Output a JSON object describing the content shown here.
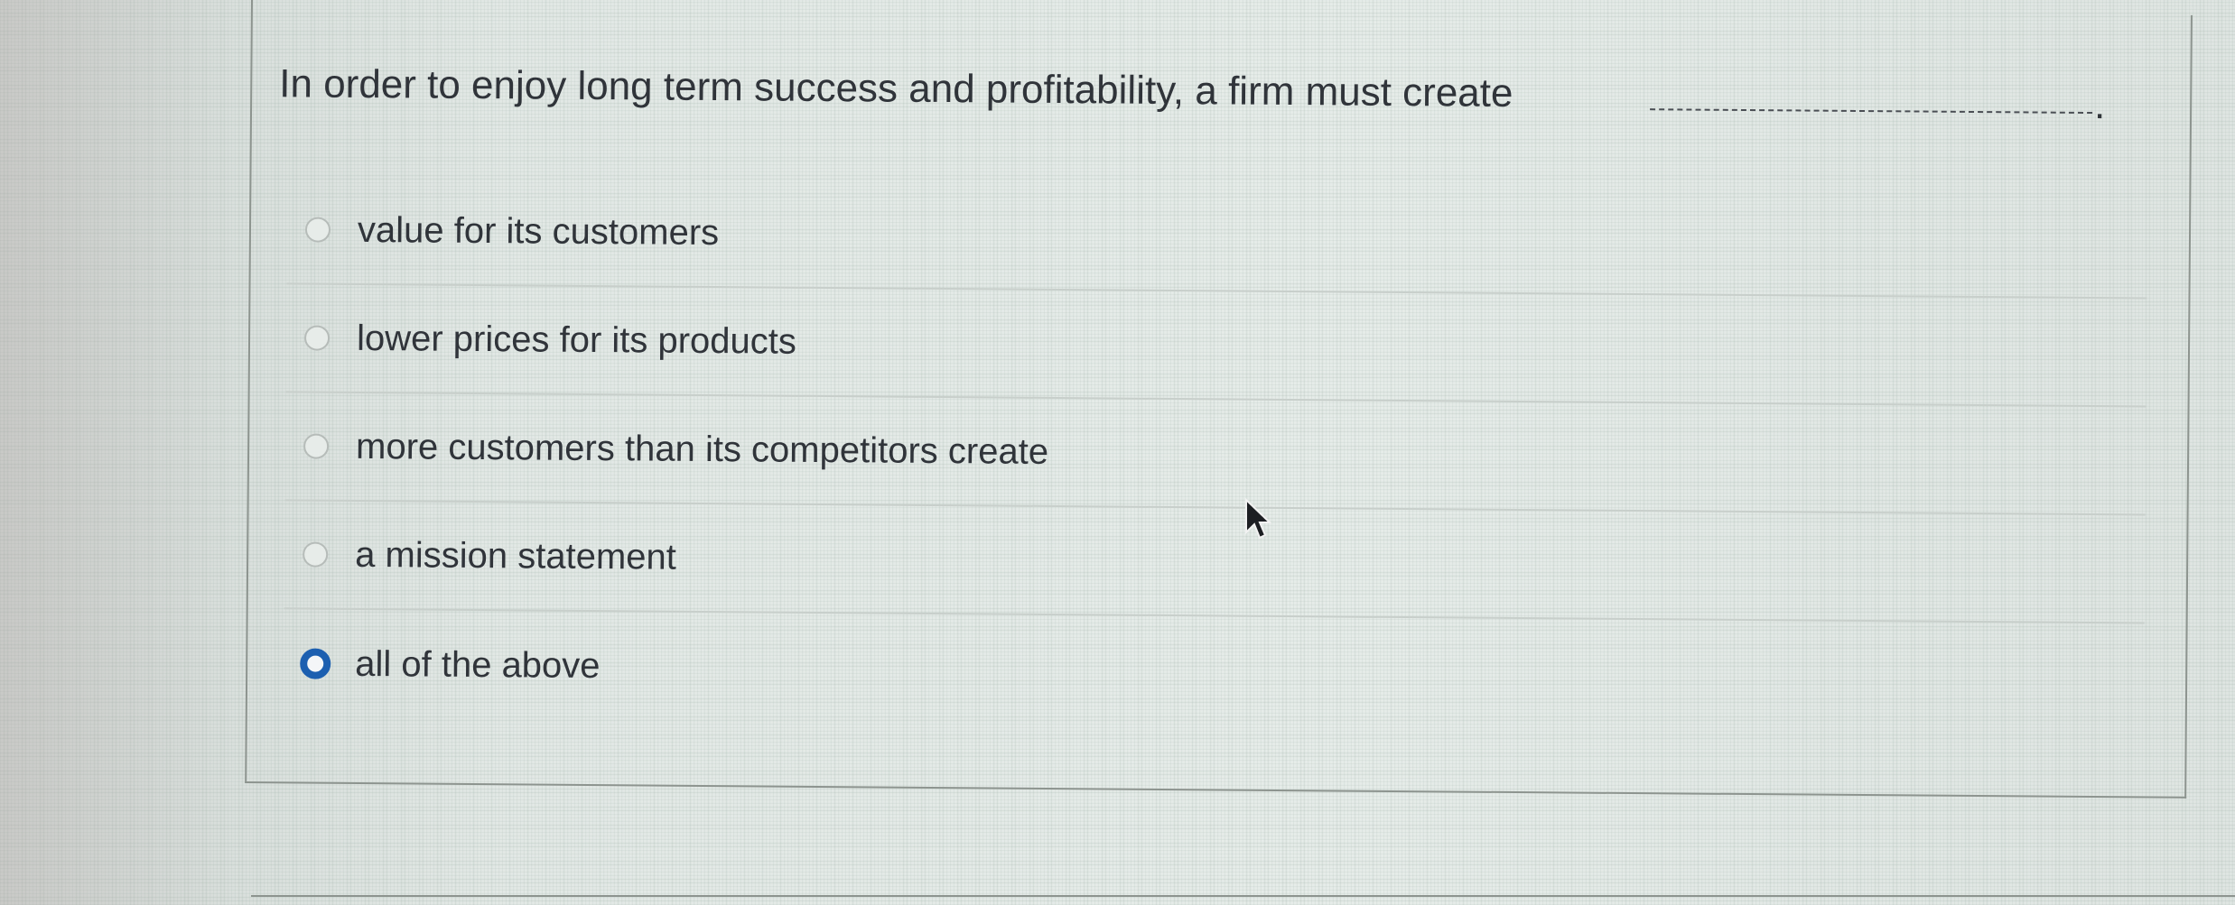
{
  "question": {
    "text": "In order to enjoy long term success and profitability, a firm must create",
    "end_punctuation": "."
  },
  "options": [
    {
      "label": "value for its customers",
      "selected": false
    },
    {
      "label": "lower prices for its products",
      "selected": false
    },
    {
      "label": "more customers than its competitors create",
      "selected": false
    },
    {
      "label": "a mission statement",
      "selected": false
    },
    {
      "label": "all of the above",
      "selected": true
    }
  ],
  "colors": {
    "selected_radio": "#1c5fb0",
    "text": "#30343a",
    "divider": "#c8cfcb"
  },
  "icons": {
    "cursor": "mouse-pointer-icon"
  }
}
